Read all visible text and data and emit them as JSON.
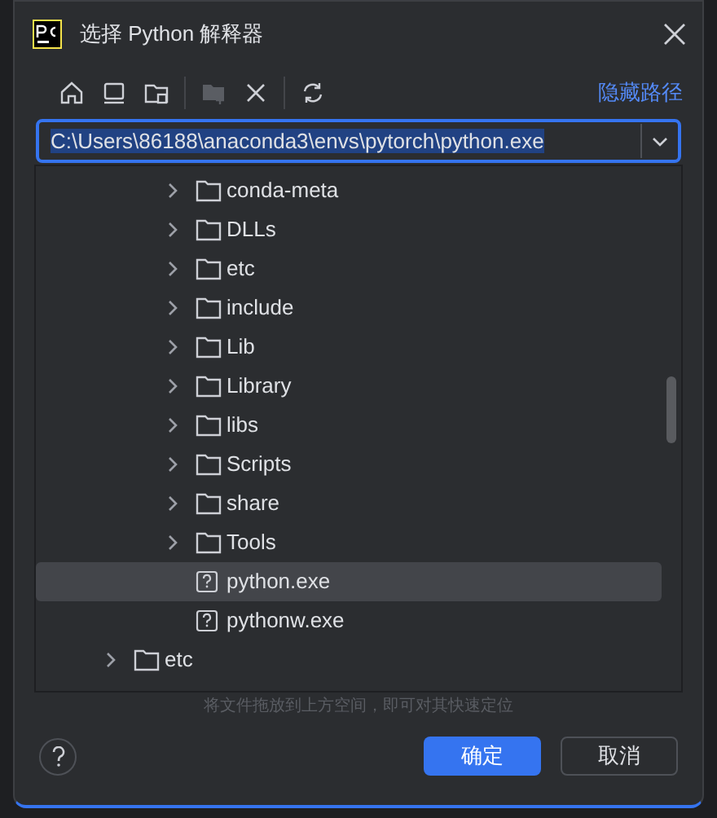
{
  "window": {
    "title": "选择 Python 解释器"
  },
  "toolbar": {
    "buttons": [
      {
        "kind": "home",
        "disabled": false
      },
      {
        "kind": "desktop",
        "disabled": false
      },
      {
        "kind": "project",
        "disabled": false
      },
      {
        "kind": "new-folder",
        "disabled": true
      },
      {
        "kind": "delete",
        "disabled": false
      },
      {
        "kind": "refresh",
        "disabled": false
      }
    ],
    "link": "隐藏路径"
  },
  "path_field": {
    "value": "C:\\Users\\86188\\anaconda3\\envs\\pytorch\\python.exe"
  },
  "tree": {
    "items": [
      {
        "children": [
          {
            "label": "conda-meta",
            "kind": "folder",
            "expanded": false,
            "selected": false
          },
          {
            "label": "DLLs",
            "kind": "folder",
            "expanded": false,
            "selected": false
          },
          {
            "label": "etc",
            "kind": "folder",
            "expanded": false,
            "selected": false
          },
          {
            "label": "include",
            "kind": "folder",
            "expanded": false,
            "selected": false
          },
          {
            "label": "Lib",
            "kind": "folder",
            "expanded": false,
            "selected": false
          },
          {
            "label": "Library",
            "kind": "folder",
            "expanded": false,
            "selected": false
          },
          {
            "label": "libs",
            "kind": "folder",
            "expanded": false,
            "selected": false
          },
          {
            "label": "Scripts",
            "kind": "folder",
            "expanded": false,
            "selected": false
          },
          {
            "label": "share",
            "kind": "folder",
            "expanded": false,
            "selected": false
          },
          {
            "label": "Tools",
            "kind": "folder",
            "expanded": false,
            "selected": false
          },
          {
            "label": "python.exe",
            "kind": "file",
            "selected": true
          },
          {
            "label": "pythonw.exe",
            "kind": "file",
            "selected": false
          }
        ]
      },
      {
        "label": "etc",
        "kind": "folder",
        "expanded": false,
        "selected": false
      }
    ]
  },
  "hint": "将文件拖放到上方空间，即可对其快速定位",
  "buttons": [
    {
      "label": "确定",
      "kind": "primary"
    },
    {
      "label": "取消",
      "kind": "secondary"
    }
  ]
}
